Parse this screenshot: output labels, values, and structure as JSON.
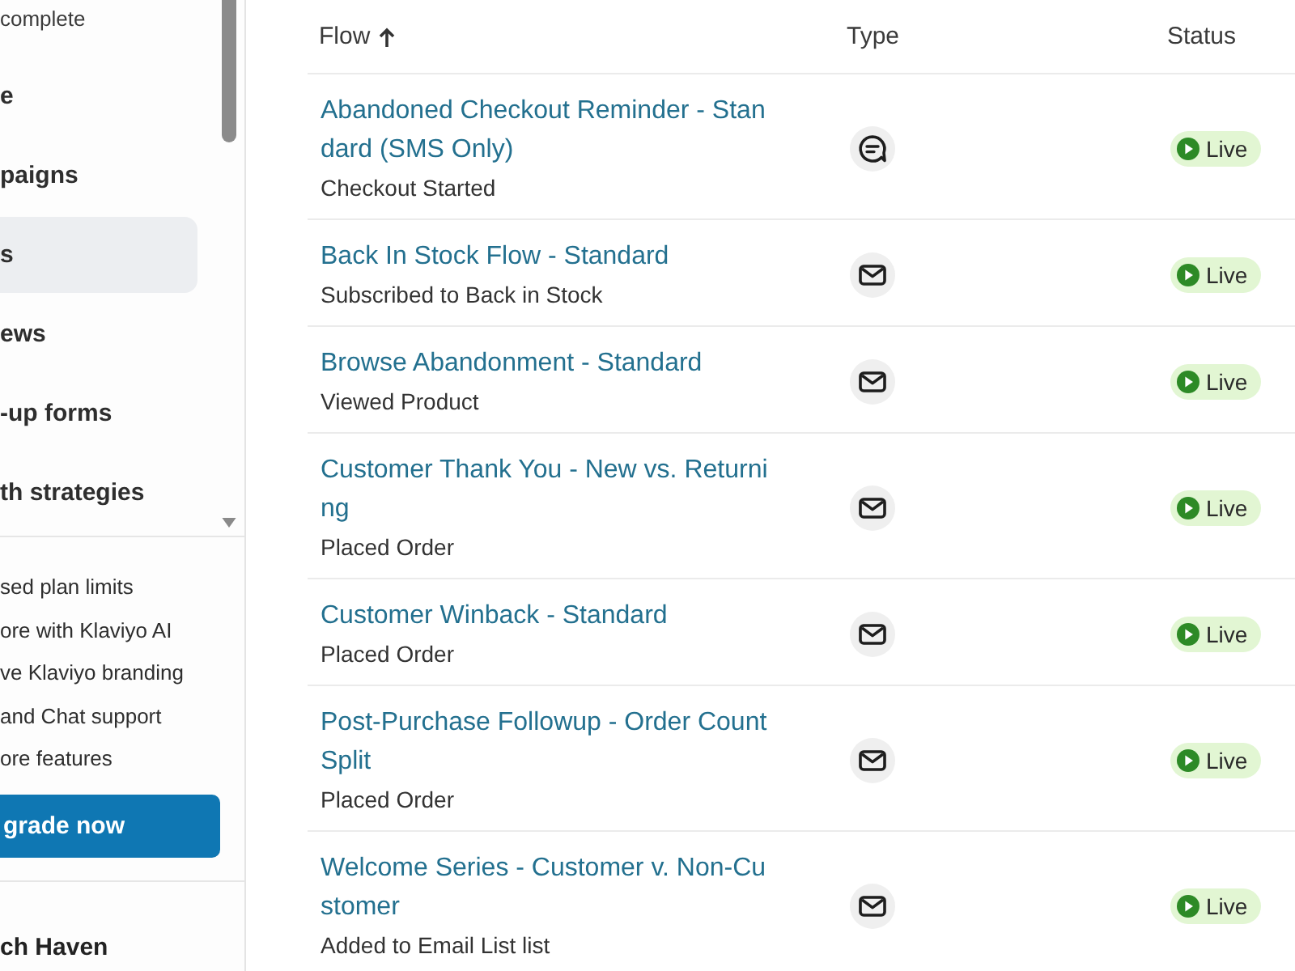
{
  "sidebar": {
    "setup_status": "complete",
    "nav_items": [
      {
        "label": "e",
        "selected": false
      },
      {
        "label": "paigns",
        "selected": false
      },
      {
        "label": "s",
        "selected": true
      },
      {
        "label": "ews",
        "selected": false
      },
      {
        "label": "-up forms",
        "selected": false
      },
      {
        "label": "th strategies",
        "selected": false
      }
    ],
    "upgrade": {
      "features": [
        "sed plan limits",
        "ore with Klaviyo AI",
        "ve Klaviyo branding",
        "and Chat support",
        "ore features"
      ],
      "button": "grade now"
    },
    "account": {
      "name": "ch Haven"
    }
  },
  "table": {
    "columns": [
      {
        "label": "Flow",
        "sorted": true
      },
      {
        "label": "Type",
        "sorted": false
      },
      {
        "label": "Status",
        "sorted": false
      }
    ],
    "rows": [
      {
        "name": "Abandoned Checkout Reminder - Standard (SMS Only)",
        "trigger": "Checkout Started",
        "kind": "sms",
        "status": {
          "label": "Live",
          "kind": "live"
        }
      },
      {
        "name": "Back In Stock Flow - Standard",
        "trigger": "Subscribed to Back in Stock",
        "kind": "email",
        "status": {
          "label": "Live",
          "kind": "live"
        }
      },
      {
        "name": "Browse Abandonment - Standard",
        "trigger": "Viewed Product",
        "kind": "email",
        "status": {
          "label": "Live",
          "kind": "live"
        }
      },
      {
        "name": "Customer Thank You - New vs. Returning",
        "trigger": "Placed Order",
        "kind": "email",
        "status": {
          "label": "Live",
          "kind": "live"
        }
      },
      {
        "name": "Customer Winback - Standard",
        "trigger": "Placed Order",
        "kind": "email",
        "status": {
          "label": "Live",
          "kind": "live"
        }
      },
      {
        "name": "Post-Purchase Followup - Order Count Split",
        "trigger": "Placed Order",
        "kind": "email",
        "status": {
          "label": "Live",
          "kind": "live"
        }
      },
      {
        "name": "Welcome Series - Customer v. Non-Customer",
        "trigger": "Added to Email List list",
        "kind": "email",
        "status": {
          "label": "Live",
          "kind": "live"
        }
      }
    ]
  }
}
